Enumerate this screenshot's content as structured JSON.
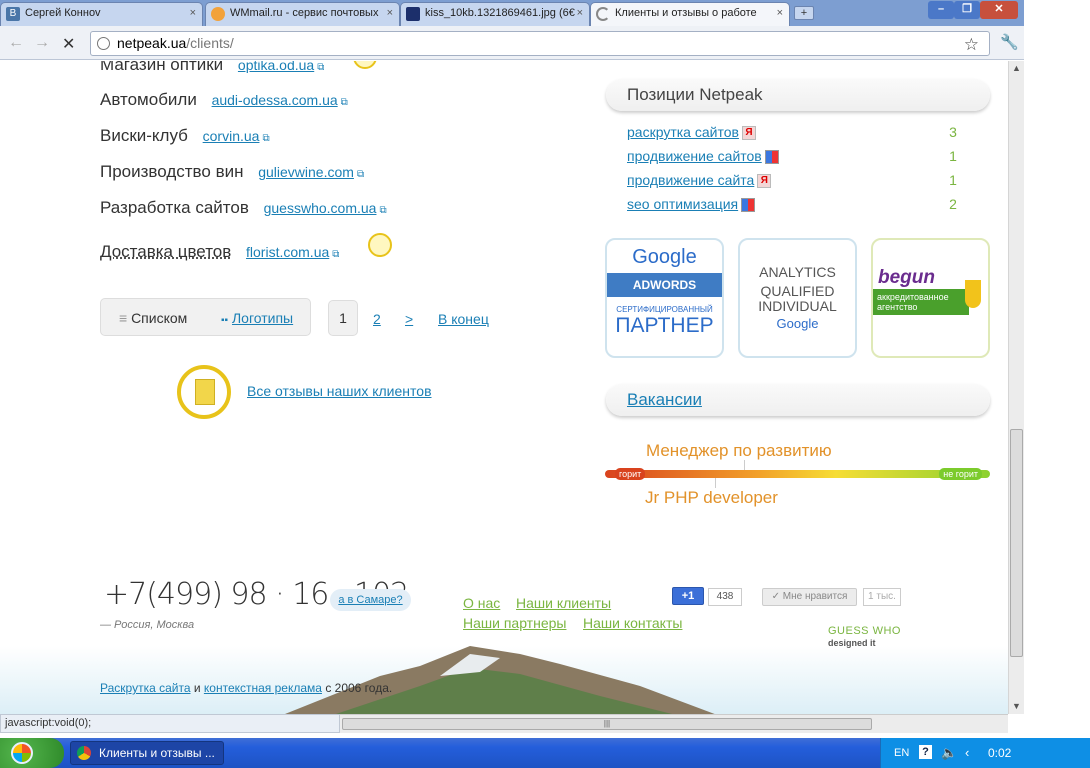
{
  "browser": {
    "tabs": [
      {
        "title": "Сергей Конноv",
        "close": "×"
      },
      {
        "title": "WMmail.ru - сервис почтовых",
        "close": "×"
      },
      {
        "title": "kiss_10kb.1321869461.jpg (6€",
        "close": "×"
      },
      {
        "title": "Клиенты и отзывы о работе",
        "close": "×"
      }
    ],
    "new_tab": "+",
    "url_host": "netpeak.ua",
    "url_path": "/clients/"
  },
  "clients": [
    {
      "name": "Магазин оптики",
      "site": "optika.od.ua"
    },
    {
      "name": "Автомобили",
      "site": "audi-odessa.com.ua"
    },
    {
      "name": "Виски-клуб",
      "site": "corvin.ua"
    },
    {
      "name": "Производство вин",
      "site": "gulievwine.com"
    },
    {
      "name": "Разработка сайтов",
      "site": "guesswho.com.ua"
    },
    {
      "name": "Доставка цветов",
      "site": "florist.com.ua"
    }
  ],
  "view": {
    "list_label": "Списком",
    "logos_label": "Логотипы"
  },
  "pager": {
    "current": "1",
    "next_page": "2",
    "next_arrow": ">",
    "last": "В конец"
  },
  "all_reviews": "Все отзывы наших клиентов",
  "positions": {
    "title": "Позиции Netpeak",
    "items": [
      {
        "query": "раскрутка сайтов",
        "engine": "yandex",
        "engine_glyph": "Я",
        "rank": "3"
      },
      {
        "query": "продвижение сайтов",
        "engine": "google",
        "engine_glyph": "",
        "rank": "1"
      },
      {
        "query": "продвижение сайта",
        "engine": "yandex",
        "engine_glyph": "Я",
        "rank": "1"
      },
      {
        "query": "seo оптимизация",
        "engine": "google",
        "engine_glyph": "",
        "rank": "2"
      }
    ]
  },
  "badges": {
    "adwords": {
      "google": "Google",
      "line": "ADWORDS",
      "cert": "СЕРТИФИЦИРОВАННЫЙ",
      "partner": "ПАРТНЕР"
    },
    "analytics": {
      "l1": "ANALYTICS",
      "l2": "QUALIFIED",
      "l3": "INDIVIDUAL",
      "google": "Google"
    },
    "begun": {
      "brand": "begun",
      "l1": "аккредитованное",
      "l2": "агентство"
    }
  },
  "vacancies": {
    "title": "Вакансии",
    "hot": "горит",
    "not_hot": "не горит",
    "items": [
      "Менеджер по развитию",
      "Jr PHP developer"
    ]
  },
  "footer": {
    "phone": "+7(499) 98 · 16 · 102",
    "location": "— Россия, Москва",
    "samara": "а в Самаре?",
    "links": [
      "О нас",
      "Наши клиенты",
      "Наши партнеры",
      "Наши контакты"
    ],
    "plus_one": "+1",
    "plus_count": "438",
    "like": "✓ Мне нравится",
    "like_count": "1 тыс.",
    "guesswho": "GUESS WHO",
    "designed": "designed it",
    "seo_link": "Раскрутка сайта",
    "and": "и",
    "ctx_link": "контекстная реклама",
    "since": "с 2006 года."
  },
  "status_text": "javascript:void(0);",
  "taskbar": {
    "task": "Клиенты и отзывы ...",
    "lang": "EN",
    "help": "?",
    "time": "0:02"
  },
  "colors": {
    "link": "#1a7fb5",
    "green_link": "#7ab540",
    "vacancy": "#e2922a",
    "medal": "#e8c31a"
  }
}
